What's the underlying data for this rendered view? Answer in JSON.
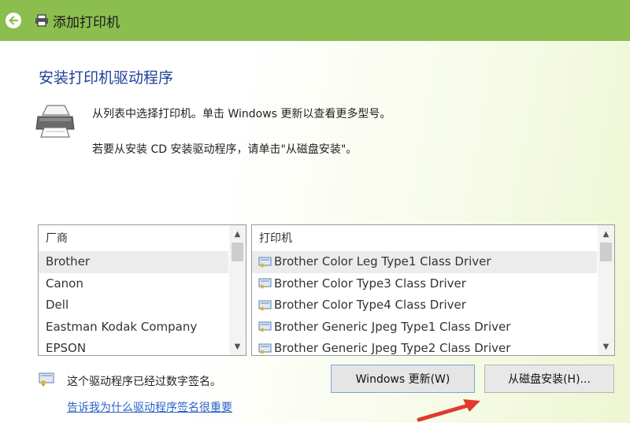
{
  "window": {
    "title": "添加打印机",
    "accent_color": "#8cbd4f",
    "back_icon": "back-arrow-icon",
    "title_icon": "printer-icon"
  },
  "main": {
    "heading": "安装打印机驱动程序",
    "instruction_line1": "从列表中选择打印机。单击 Windows 更新以查看更多型号。",
    "instruction_line2": "若要从安装 CD 安装驱动程序，请单击\"从磁盘安装\"。"
  },
  "manufacturers": {
    "header": "厂商",
    "items": [
      "Brother",
      "Canon",
      "Dell",
      "Eastman Kodak Company",
      "EPSON"
    ],
    "selected": "Brother"
  },
  "printers": {
    "header": "打印机",
    "items": [
      "Brother Color Leg Type1 Class Driver",
      "Brother Color Type3 Class Driver",
      "Brother Color Type4 Class Driver",
      "Brother Generic Jpeg Type1 Class Driver",
      "Brother Generic Jpeg Type2 Class Driver"
    ],
    "selected": "Brother Color Leg Type1 Class Driver"
  },
  "footer": {
    "signed_text": "这个驱动程序已经过数字签名。",
    "why_link": "告诉我为什么驱动程序签名很重要",
    "windows_update_button": "Windows 更新(W)",
    "have_disk_button": "从磁盘安装(H)...",
    "annotation_arrow_color": "#e03a2f"
  }
}
